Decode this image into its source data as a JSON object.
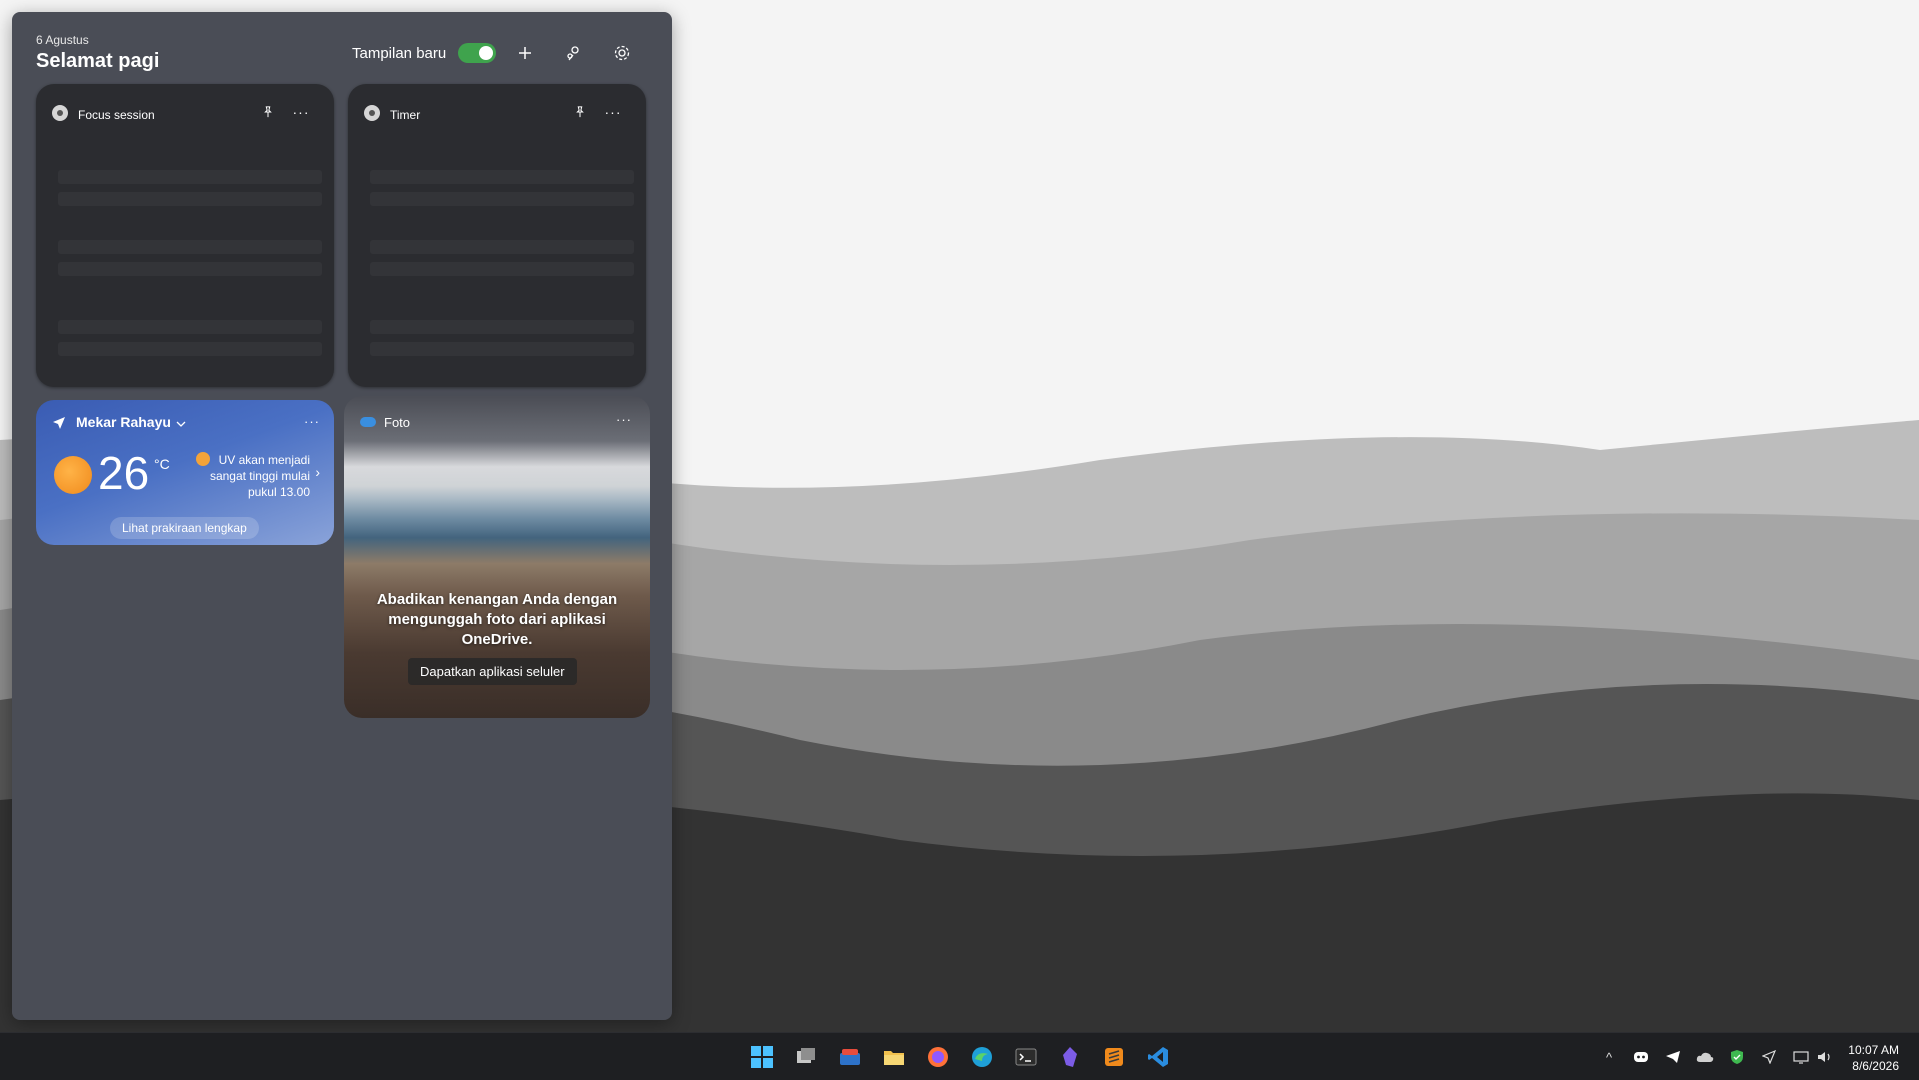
{
  "header": {
    "date": "6 Agustus",
    "greeting": "Selamat pagi",
    "toggle_label": "Tampilan baru",
    "toggle_on": true
  },
  "cards": {
    "focus": {
      "title": "Focus session"
    },
    "timer": {
      "title": "Timer"
    }
  },
  "weather": {
    "location": "Mekar Rahayu",
    "temperature": "26",
    "unit": "°C",
    "uv_line1": "UV akan menjadi",
    "uv_line2": "sangat tinggi mulai",
    "uv_line3": "pukul 13.00",
    "cta": "Lihat prakiraan lengkap"
  },
  "photos": {
    "title": "Foto",
    "message": "Abadikan kenangan Anda dengan mengunggah foto dari aplikasi OneDrive.",
    "button": "Dapatkan aplikasi seluler"
  },
  "taskbar": {
    "apps": [
      "start-icon",
      "task-view-icon",
      "widgets-icon",
      "file-explorer-icon",
      "firefox-icon",
      "edge-icon",
      "terminal-icon",
      "obsidian-icon",
      "sublime-text-icon",
      "vscode-icon"
    ],
    "tray": [
      "chevron-up-icon",
      "discord-icon",
      "telegram-icon",
      "onedrive-icon",
      "defender-icon",
      "location-icon",
      "network-icon",
      "volume-icon"
    ],
    "time": "10:07 AM",
    "date": "8/6/2026"
  },
  "colors": {
    "panel": "#4a4d56",
    "toggle_on": "#3fa34d",
    "taskbar": "#1e1f22"
  }
}
